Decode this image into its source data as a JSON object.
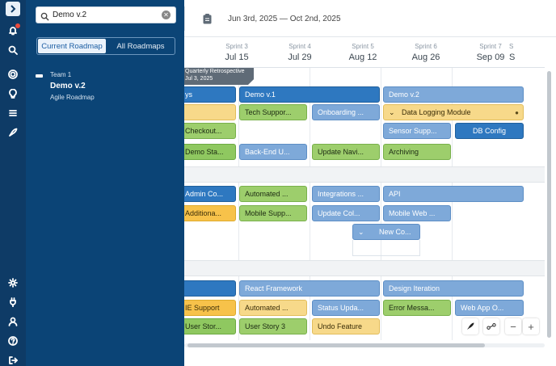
{
  "rail": {
    "icons": [
      "expand-icon",
      "bell-icon",
      "search-icon",
      "target-icon",
      "lightbulb-icon",
      "list-icon",
      "rocket-icon",
      "gear-icon",
      "plug-icon",
      "user-icon",
      "help-icon",
      "logout-icon"
    ]
  },
  "search": {
    "value": "Demo v.2",
    "tabs": {
      "current": "Current Roadmap",
      "all": "All Roadmaps"
    },
    "result": {
      "team": "Team 1",
      "name": "Demo v.2",
      "type": "Agile Roadmap"
    }
  },
  "topbar": {
    "date_range": "Jun 3rd, 2025  —  Oct 2nd, 2025"
  },
  "sprints": [
    {
      "label": "Sprint 3",
      "date": "Jul 15"
    },
    {
      "label": "Sprint 4",
      "date": "Jul 29"
    },
    {
      "label": "Sprint 5",
      "date": "Aug 12"
    },
    {
      "label": "Sprint 6",
      "date": "Aug 26"
    },
    {
      "label": "Sprint 7",
      "date": "Sep 09"
    },
    {
      "label": "S",
      "date": "S"
    }
  ],
  "milestone": {
    "title": "Quarterly Retrospective",
    "date": "Jul 3, 2025"
  },
  "cards": {
    "r1": [
      "ys",
      "Demo v.1",
      "Demo v.2"
    ],
    "r2": [
      "",
      "Tech Suppor...",
      "Onboarding ...",
      "Data Logging Module"
    ],
    "r3": [
      "Checkout...",
      "Sensor Supp...",
      "DB Config"
    ],
    "r4": [
      "Demo Sta...",
      "Back-End U...",
      "Update Navi...",
      "Archiving"
    ],
    "r5": [
      "Admin Co...",
      "Automated ...",
      "Integrations ...",
      "API"
    ],
    "r6": [
      "Additiona...",
      "Mobile Supp...",
      "Update Col...",
      "Mobile Web ..."
    ],
    "r7": [
      "New Co..."
    ],
    "r8": [
      "",
      "React Framework",
      "Design Iteration"
    ],
    "r9": [
      "IE Support",
      "Automated ...",
      "Status Upda...",
      "Error Messa...",
      "Web App O..."
    ],
    "r10": [
      "User Stor...",
      "User Story 3",
      "Undo Feature"
    ]
  },
  "zoom": {
    "minus": "−",
    "plus": "+"
  }
}
